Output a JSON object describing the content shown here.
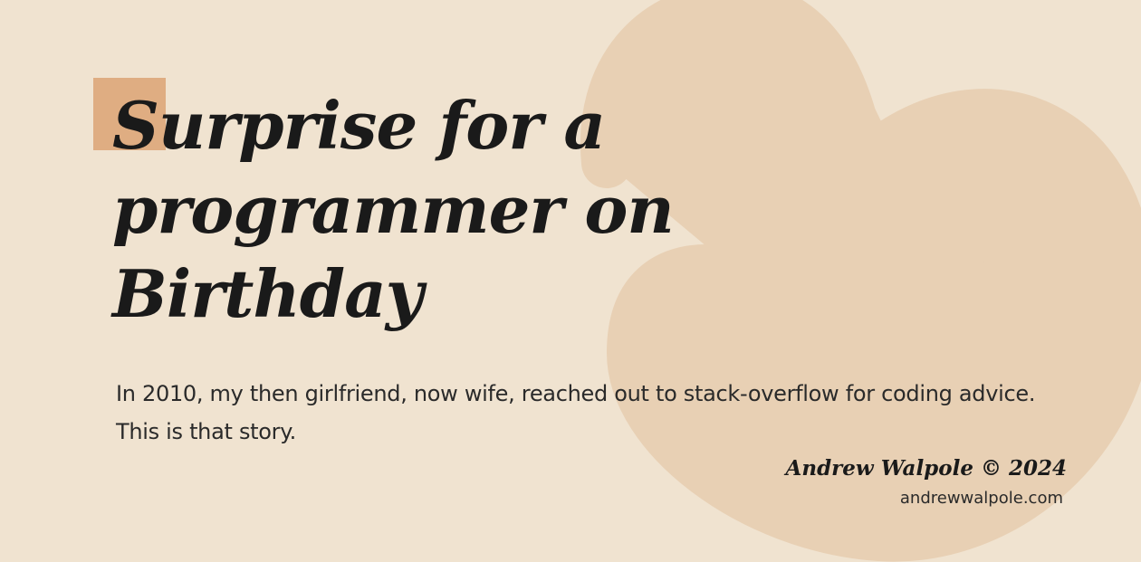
{
  "colors": {
    "background": "#f0e3d0",
    "ampersand": "#e8d0b4",
    "accent_square": "#dfad82",
    "text": "#1a1a1a"
  },
  "icons": {
    "background_glyph": "ampersand-icon"
  },
  "title": {
    "lines": [
      "Surprise for a",
      "programmer on",
      "Birthday"
    ]
  },
  "subtitle": "In 2010, my then girlfriend, now wife, reached out to stack-overflow for coding advice. This is that story.",
  "author": "Andrew Walpole © 2024",
  "site": "andrewwalpole.com"
}
